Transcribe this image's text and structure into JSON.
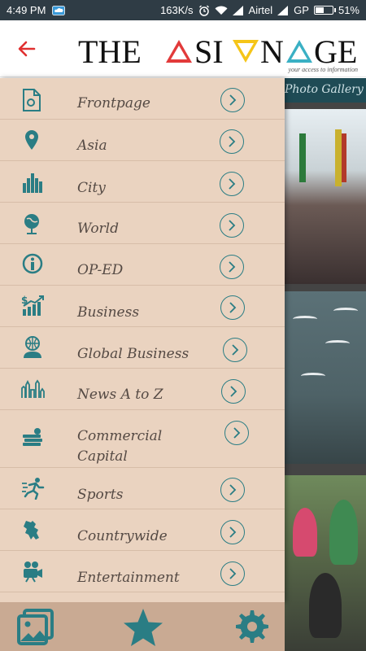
{
  "status_bar": {
    "time": "4:49 PM",
    "speed": "163K/s",
    "carrier": "Airtel",
    "network": "GP",
    "battery": "51%",
    "battery_level": 0.51
  },
  "header": {
    "logo_text": "THE ASIAN AGE",
    "tagline": "your access to information"
  },
  "background": {
    "gallery_label": "Photo Gallery"
  },
  "menu": {
    "items": [
      {
        "label": "Frontpage",
        "icon": "document-icon"
      },
      {
        "label": "Asia",
        "icon": "location-pin-icon"
      },
      {
        "label": "City",
        "icon": "city-skyline-icon"
      },
      {
        "label": "World",
        "icon": "globe-icon"
      },
      {
        "label": "OP-ED",
        "icon": "info-icon"
      },
      {
        "label": "Business",
        "icon": "growth-chart-icon"
      },
      {
        "label": "Global Business",
        "icon": "global-business-icon"
      },
      {
        "label": "News A to Z",
        "icon": "landmarks-icon"
      },
      {
        "label": "Commercial Capital",
        "icon": "money-stack-icon"
      },
      {
        "label": "Sports",
        "icon": "runner-icon"
      },
      {
        "label": "Countrywide",
        "icon": "country-map-icon"
      },
      {
        "label": "Entertainment",
        "icon": "video-camera-icon"
      }
    ]
  },
  "colors": {
    "accent": "#2a7d84",
    "drawer_bg": "#ead3c0",
    "bottom_bar": "#c9aa93",
    "back_arrow": "#e03030",
    "status_bar": "#2f3c45"
  }
}
